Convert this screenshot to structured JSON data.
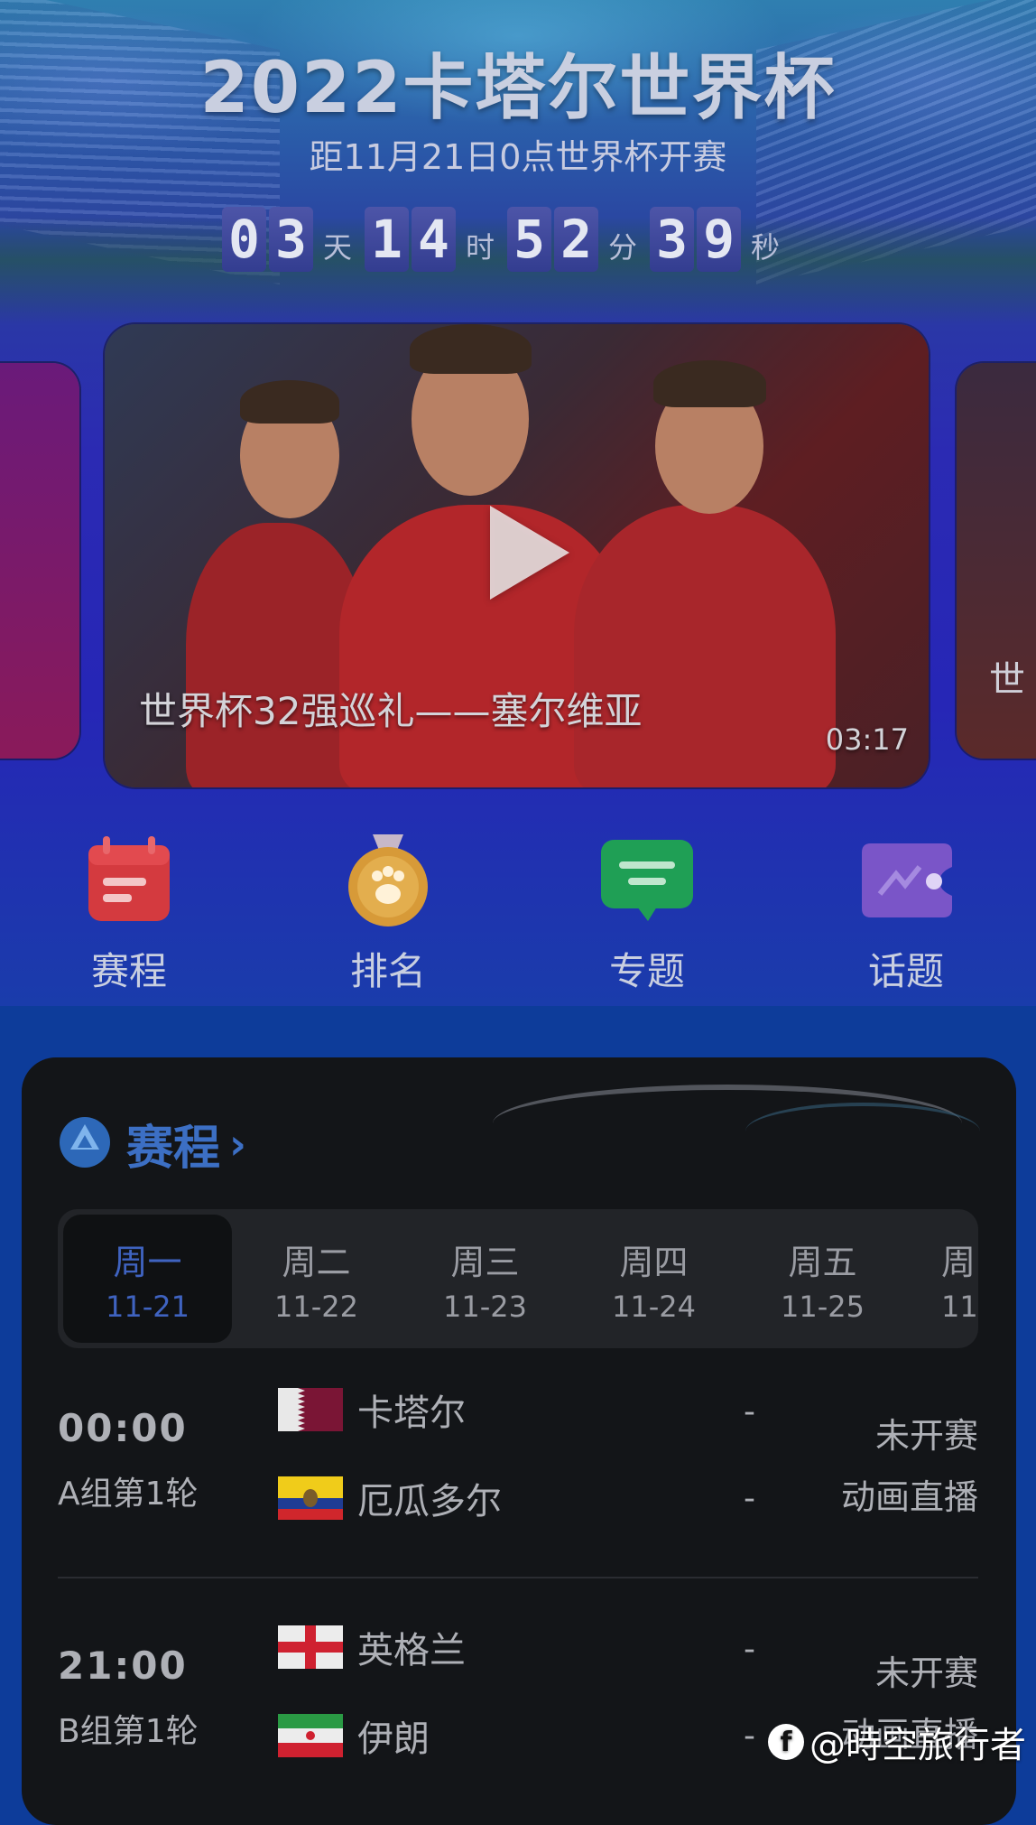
{
  "banner": {
    "title": "2022卡塔尔世界杯",
    "subtitle": "距11月21日0点世界杯开赛",
    "countdown": {
      "days": [
        "0",
        "3"
      ],
      "days_unit": "天",
      "hours": [
        "1",
        "4"
      ],
      "hours_unit": "时",
      "minutes": [
        "5",
        "2"
      ],
      "minutes_unit": "分",
      "seconds": [
        "3",
        "9"
      ],
      "seconds_unit": "秒"
    }
  },
  "carousel": {
    "current": {
      "title": "世界杯32强巡礼——塞尔维亚",
      "duration": "03:17"
    },
    "next_peek": "世"
  },
  "nav": [
    {
      "label": "赛程",
      "icon": "calendar-icon",
      "color": "#e0393d"
    },
    {
      "label": "排名",
      "icon": "medal-icon",
      "color": "#e6a838"
    },
    {
      "label": "专题",
      "icon": "chat-icon",
      "color": "#1db55a"
    },
    {
      "label": "话题",
      "icon": "ticket-icon",
      "color": "#8a5be0"
    }
  ],
  "schedule": {
    "title": "赛程",
    "tabs": [
      {
        "day": "周一",
        "date": "11-21",
        "active": true
      },
      {
        "day": "周二",
        "date": "11-22"
      },
      {
        "day": "周三",
        "date": "11-23"
      },
      {
        "day": "周四",
        "date": "11-24"
      },
      {
        "day": "周五",
        "date": "11-25"
      },
      {
        "day": "周",
        "date": "11"
      }
    ],
    "matches": [
      {
        "time": "00:00",
        "round": "A组第1轮",
        "home": {
          "name": "卡塔尔",
          "flag": "qatar-flag"
        },
        "away": {
          "name": "厄瓜多尔",
          "flag": "ecuador-flag"
        },
        "home_score": "-",
        "away_score": "-",
        "status": "未开赛",
        "broadcast": "动画直播"
      },
      {
        "time": "21:00",
        "round": "B组第1轮",
        "home": {
          "name": "英格兰",
          "flag": "england-flag"
        },
        "away": {
          "name": "伊朗",
          "flag": "iran-flag"
        },
        "home_score": "-",
        "away_score": "-",
        "status": "未开赛",
        "broadcast": "动画直播"
      }
    ]
  },
  "watermark": {
    "logo": "f",
    "text": "@時空旅行者"
  }
}
